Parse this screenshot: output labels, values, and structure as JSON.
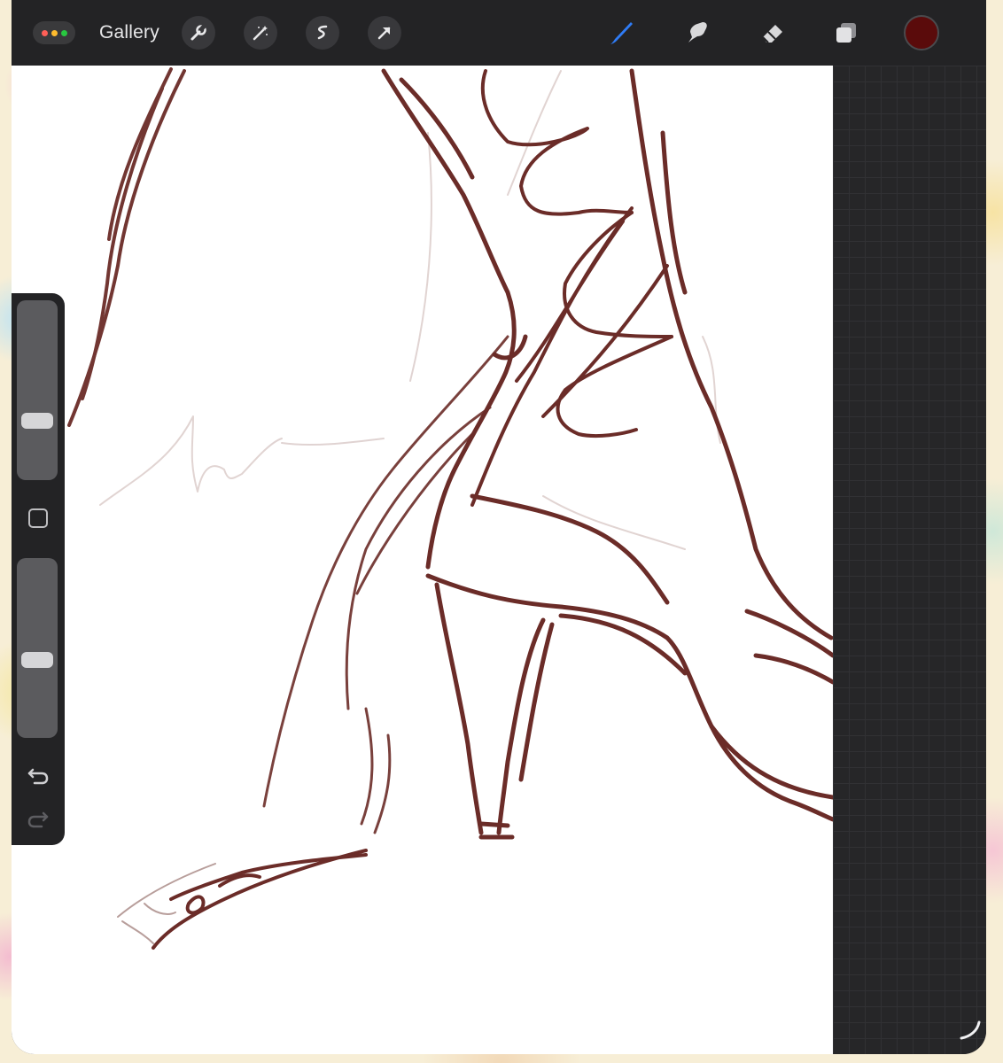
{
  "toolbar": {
    "gallery_label": "Gallery",
    "dots_colors": [
      "#ff5f57",
      "#febc2e",
      "#28c840"
    ],
    "actions_icons": [
      "wrench-icon",
      "magic-wand-icon",
      "selection-icon",
      "transform-arrow-icon"
    ],
    "tools_icons": [
      "brush-icon",
      "smudge-icon",
      "eraser-icon",
      "layers-icon"
    ],
    "active_tool": "brush",
    "active_color": "#5a0b0b",
    "accent": "#2f7cf6"
  },
  "sidebar": {
    "brush_size": 0.3,
    "opacity": 0.42,
    "icons": [
      "modify-square-icon",
      "undo-icon",
      "redo-icon"
    ]
  },
  "canvas": {
    "stroke_color": "#6b2c28",
    "background": "#ffffff"
  }
}
